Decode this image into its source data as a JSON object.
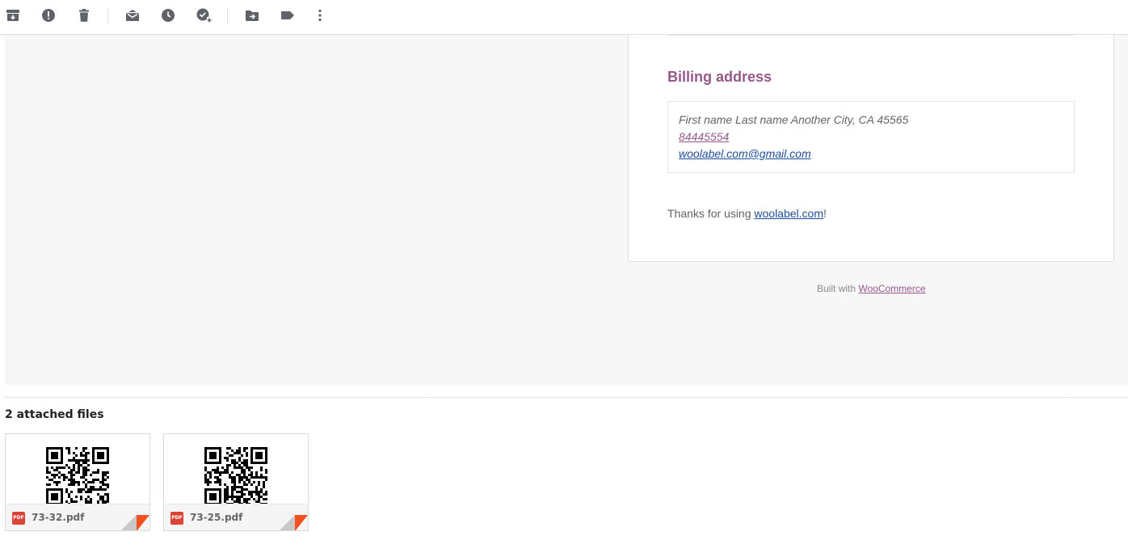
{
  "toolbar": {
    "icons": [
      "archive-icon",
      "report-spam-icon",
      "delete-icon",
      "mark-unread-icon",
      "snooze-icon",
      "add-task-icon",
      "move-to-icon",
      "label-icon",
      "more-options-icon"
    ]
  },
  "email": {
    "billing_title": "Billing address",
    "address_line": "First name Last name Another City, CA 45565",
    "phone": "84445554",
    "email": "woolabel.com@gmail.com",
    "thanks_prefix": "Thanks for using ",
    "thanks_link": "woolabel.com",
    "thanks_suffix": "!",
    "footer_prefix": "Built with ",
    "footer_link": "WooCommerce"
  },
  "attachments": {
    "heading": "2 attached files",
    "type_badge": "PDF",
    "files": [
      {
        "name": "73-32.pdf"
      },
      {
        "name": "73-25.pdf"
      }
    ]
  },
  "colors": {
    "brand_purple": "#96588a",
    "link_blue": "#1f4e9c",
    "pdf_red": "#db4437",
    "fold_red": "#f4511e"
  }
}
